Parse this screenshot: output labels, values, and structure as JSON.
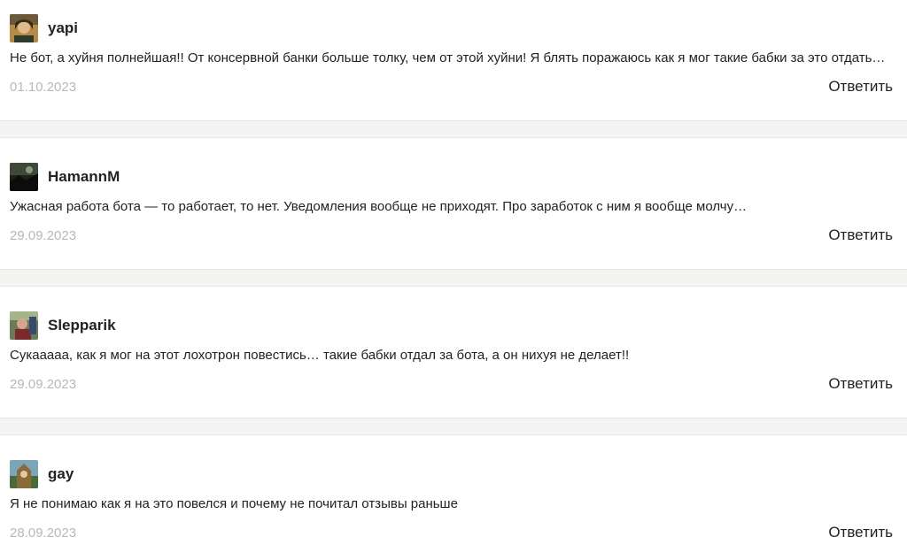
{
  "reply_label": "Ответить",
  "comments": [
    {
      "author": "yapi",
      "text": "Не бот, а хуйня полнейшая!! От консервной банки больше толку, чем от этой хуйни! Я блять поражаюсь как я мог такие бабки за это отдать…",
      "date": "01.10.2023"
    },
    {
      "author": "HamannM",
      "text": "Ужасная работа бота — то работает, то нет. Уведомления вообще не приходят. Про заработок с ним я вообще молчу…",
      "date": "29.09.2023"
    },
    {
      "author": "Slepparik",
      "text": "Сукааааа, как я мог на этот лохотрон повестись… такие бабки отдал за бота, а он нихуя не делает!!",
      "date": "29.09.2023"
    },
    {
      "author": "gay",
      "text": "Я не понимаю как я на это повелся и почему не почитал отзывы раньше",
      "date": "28.09.2023"
    }
  ]
}
